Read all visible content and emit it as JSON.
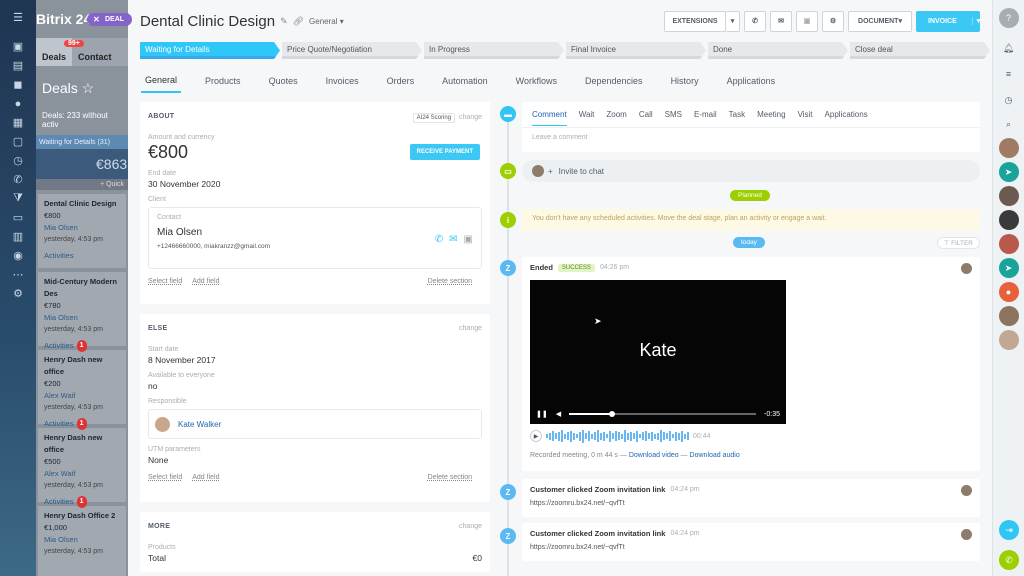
{
  "background": {
    "app_name": "Bitrix 24",
    "deal_tag": "DEAL",
    "tabs": [
      {
        "label": "Deals",
        "badge": "99+"
      },
      {
        "label": "Contact"
      }
    ],
    "page_title": "Deals",
    "deals_count_label": "Deals:",
    "deals_count": "233",
    "deals_filter_suffix": "without activ",
    "column_stage": "Waiting for Details",
    "column_count": "(31)",
    "column_amount": "€863",
    "quick_label": "+ Quick",
    "cards": [
      {
        "title": "Dental Clinic Design",
        "amount": "€800",
        "person": "Mia Olsen",
        "time": "yesterday, 4:53 pm",
        "activities": "Activities",
        "count": ""
      },
      {
        "title": "Mid-Century Modern Des",
        "amount": "€780",
        "person": "Mia Olsen",
        "time": "yesterday, 4:53 pm",
        "activities": "Activities",
        "count": "1"
      },
      {
        "title": "Henry Dash new office",
        "amount": "€200",
        "person": "Alex Waif",
        "time": "yesterday, 4:53 pm",
        "activities": "Activities",
        "count": "1"
      },
      {
        "title": "Henry Dash new office",
        "amount": "€500",
        "person": "Alex Waif",
        "time": "yesterday, 4:53 pm",
        "activities": "Activities",
        "count": "1"
      },
      {
        "title": "Henry Dash Office 2",
        "amount": "€1,000",
        "person": "Mia Olsen",
        "time": "yesterday, 4:53 pm",
        "activities": "",
        "count": ""
      }
    ]
  },
  "header": {
    "title": "Dental Clinic  Design",
    "pipeline": "General",
    "buttons": {
      "extensions": "EXTENSIONS",
      "document": "DOCUMENT",
      "invoice": "INVOICE"
    }
  },
  "stages": [
    "Waiting for Details",
    "Price Quote/Negotiation",
    "In Progress",
    "Final Invoice",
    "Done",
    "Close deal"
  ],
  "tabs": [
    "General",
    "Products",
    "Quotes",
    "Invoices",
    "Orders",
    "Automation",
    "Workflows",
    "Dependencies",
    "History",
    "Applications"
  ],
  "about": {
    "title": "ABOUT",
    "ai_label": "AI24 Scoring",
    "change": "change",
    "amount_label": "Amount and currency",
    "amount": "€800",
    "receive_payment": "RECEIVE PAYMENT",
    "end_date_label": "End date",
    "end_date": "30 November 2020",
    "client_label": "Client",
    "contact_label": "Contact",
    "contact_name": "Mia Olsen",
    "contact_info": "+12466660000, miakranzz@gmail.com",
    "select_field": "Select field",
    "add_field": "Add field",
    "delete_section": "Delete section"
  },
  "else": {
    "title": "ELSE",
    "change": "change",
    "start_date_label": "Start date",
    "start_date": "8 November 2017",
    "available_label": "Available to everyone",
    "available": "no",
    "responsible_label": "Responsible",
    "responsible": "Kate Walker",
    "utm_label": "UTM parameters",
    "utm": "None",
    "select_field": "Select field",
    "add_field": "Add field",
    "delete_section": "Delete section"
  },
  "more": {
    "title": "MORE",
    "change": "change",
    "products_label": "Products",
    "total_label": "Total",
    "total": "€0"
  },
  "activity": {
    "tabs": [
      "Comment",
      "Wait",
      "Zoom",
      "Call",
      "SMS",
      "E-mail",
      "Task",
      "Meeting",
      "Visit",
      "Applications"
    ],
    "comment_placeholder": "Leave a comment",
    "invite": "Invite to chat",
    "planned": "Planned",
    "no_activities": "You don't have any scheduled activities. Move the deal stage, plan an activity or engage a wait.",
    "today": "today",
    "filter": "FILTER",
    "ended_title": "Ended",
    "ended_status": "SUCCESS",
    "ended_time": "04:26 pm",
    "video_name": "Kate",
    "video_time": "-0:35",
    "audio_time": "00:44",
    "recorded_text": "Recorded meeting, 0 m 44 s —",
    "download_video": "Download video",
    "download_audio": "Download audio",
    "events": [
      {
        "title": "Customer clicked Zoom invitation link",
        "time": "04:24 pm",
        "link": "https://zoomru.bx24.net/~qvfTt"
      },
      {
        "title": "Customer clicked Zoom invitation link",
        "time": "04:24 pm",
        "link": "https://zoomru.bx24.net/~qvfTt"
      }
    ]
  },
  "colors": {
    "accent": "#2fc6f6",
    "stage_active": "#2fc7f7",
    "zoom": "#5ab9f0",
    "green": "#9dcf00"
  }
}
